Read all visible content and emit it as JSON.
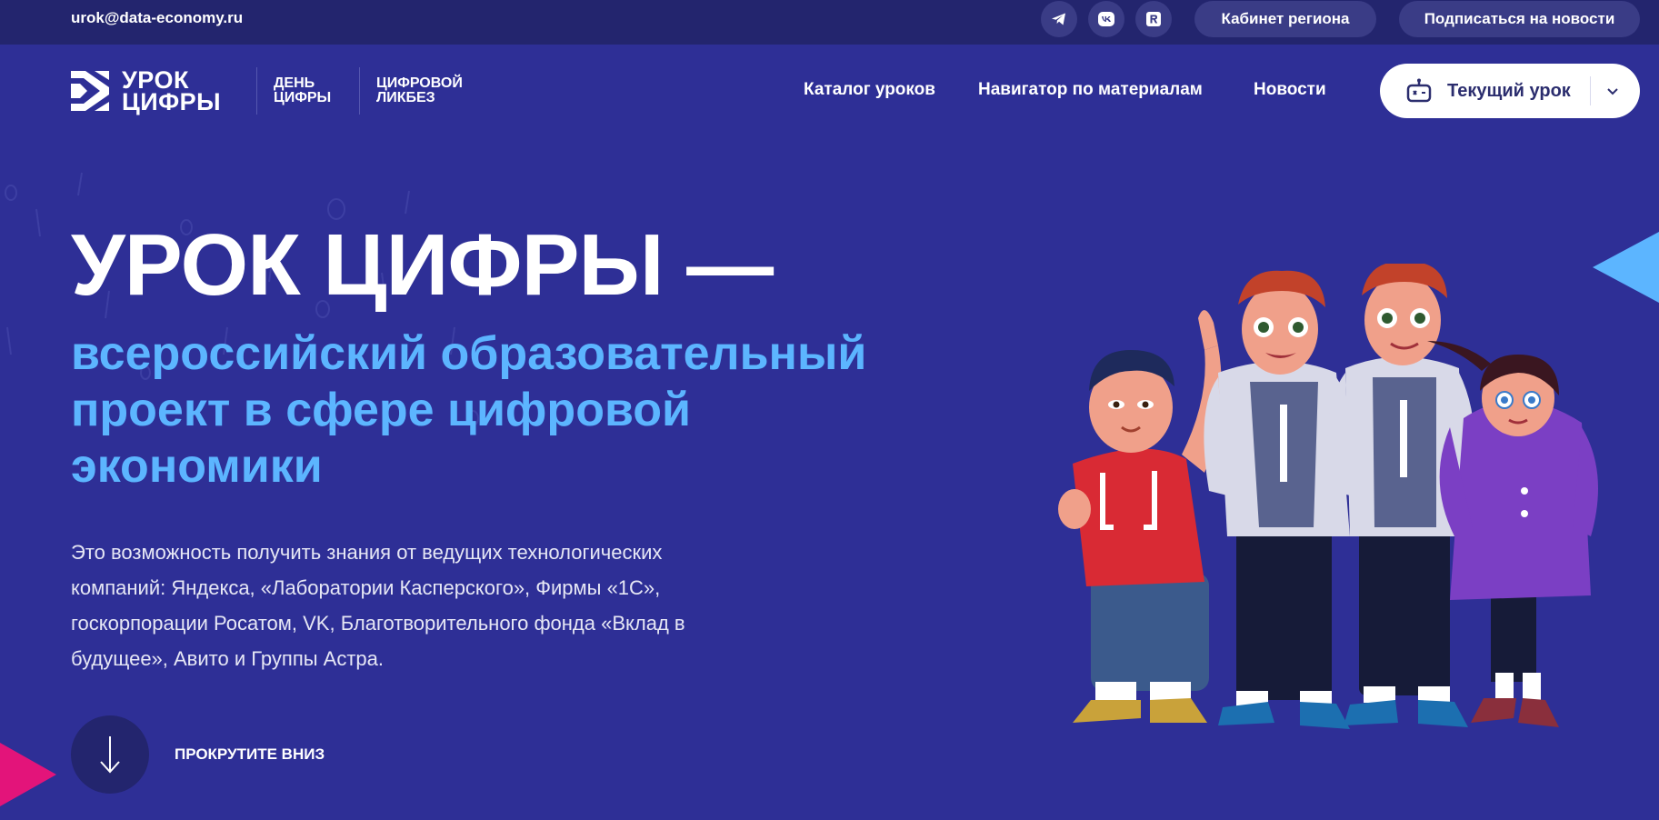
{
  "topbar": {
    "email": "urok@data-economy.ru",
    "social_icons": [
      "telegram-icon",
      "vk-icon",
      "rutube-icon"
    ],
    "region_button": "Кабинет региона",
    "subscribe_button": "Подписаться на новости"
  },
  "header": {
    "logo_main": "УРОК ЦИФРЫ",
    "logo_sub1": "ДЕНЬ ЦИФРЫ",
    "logo_sub2": "ЦИФРОВОЙ ЛИКБЕЗ",
    "nav": [
      "Каталог уроков",
      "Навигатор по материалам",
      "Новости"
    ],
    "current_lesson": "Текущий урок"
  },
  "hero": {
    "title": "УРОК ЦИФРЫ —",
    "subtitle_lines": [
      "всероссийский образовательный",
      "проект в сфере цифровой",
      "экономики"
    ],
    "description_lines": [
      "Это возможность получить знания от ведущих технологических",
      "компаний: Яндекса, «Лаборатории Касперского», Фирмы «1С»,",
      "госкорпорации Росатом, VK, Благотворительного фонда «Вклад в",
      "будущее», Авито и Группы Астра."
    ],
    "scroll_label": "ПРОКРУТИТЕ ВНИЗ"
  },
  "colors": {
    "background": "#2e2f96",
    "topbar": "#23256e",
    "accent_blue": "#5cb5ff",
    "accent_pink": "#e3147a"
  }
}
